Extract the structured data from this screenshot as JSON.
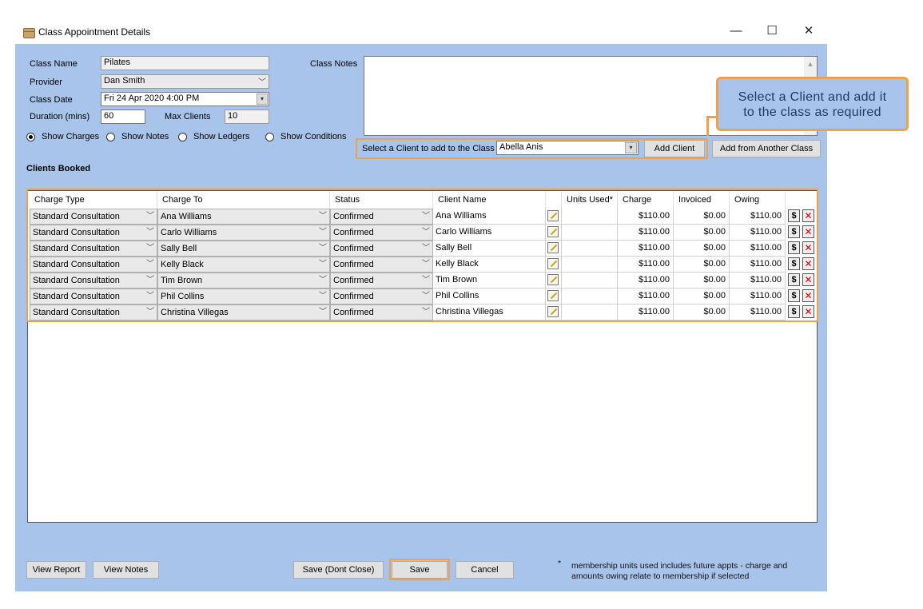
{
  "window": {
    "title": "Class Appointment Details",
    "controls": [
      "—",
      "☐",
      "✕"
    ]
  },
  "form": {
    "class_name_label": "Class Name",
    "class_name": "Pilates",
    "provider_label": "Provider",
    "provider": "Dan Smith",
    "class_date_label": "Class Date",
    "class_date": "Fri  24  Apr  2020   4:00 PM",
    "duration_label": "Duration (mins)",
    "duration": "60",
    "max_clients_label": "Max Clients",
    "max_clients": "10",
    "class_notes_label": "Class Notes",
    "radios": [
      {
        "label": "Show Charges",
        "checked": true
      },
      {
        "label": "Show Notes",
        "checked": false
      },
      {
        "label": "Show Ledgers",
        "checked": false
      },
      {
        "label": "Show Conditions",
        "checked": false
      }
    ],
    "select_client_label": "Select a Client to add to the Class",
    "select_client_value": "Abella Anis",
    "add_client_label": "Add Client",
    "add_from_another_label": "Add from Another Class",
    "clients_booked_label": "Clients Booked"
  },
  "callout": {
    "line1": "Select a Client and add it",
    "line2": "to the class as required"
  },
  "grid": {
    "columns": [
      "Charge Type",
      "Charge To",
      "Status",
      "Client Name",
      "",
      "Units Used*",
      "Charge",
      "Invoiced",
      "Owing"
    ],
    "rows": [
      {
        "charge_type": "Standard Consultation",
        "charge_to": "Ana Williams",
        "status": "Confirmed",
        "client": "Ana Williams",
        "units": "",
        "charge": "$110.00",
        "invoiced": "$0.00",
        "owing": "$110.00"
      },
      {
        "charge_type": "Standard Consultation",
        "charge_to": "Carlo Williams",
        "status": "Confirmed",
        "client": "Carlo Williams",
        "units": "",
        "charge": "$110.00",
        "invoiced": "$0.00",
        "owing": "$110.00"
      },
      {
        "charge_type": "Standard Consultation",
        "charge_to": "Sally Bell",
        "status": "Confirmed",
        "client": "Sally Bell",
        "units": "",
        "charge": "$110.00",
        "invoiced": "$0.00",
        "owing": "$110.00"
      },
      {
        "charge_type": "Standard Consultation",
        "charge_to": "Kelly Black",
        "status": "Confirmed",
        "client": "Kelly Black",
        "units": "",
        "charge": "$110.00",
        "invoiced": "$0.00",
        "owing": "$110.00"
      },
      {
        "charge_type": "Standard Consultation",
        "charge_to": "Tim Brown",
        "status": "Confirmed",
        "client": "Tim Brown",
        "units": "",
        "charge": "$110.00",
        "invoiced": "$0.00",
        "owing": "$110.00"
      },
      {
        "charge_type": "Standard Consultation",
        "charge_to": "Phil Collins",
        "status": "Confirmed",
        "client": "Phil Collins",
        "units": "",
        "charge": "$110.00",
        "invoiced": "$0.00",
        "owing": "$110.00"
      },
      {
        "charge_type": "Standard Consultation",
        "charge_to": "Christina Villegas",
        "status": "Confirmed",
        "client": "Christina Villegas",
        "units": "",
        "charge": "$110.00",
        "invoiced": "$0.00",
        "owing": "$110.00"
      }
    ],
    "dollar_symbol": "$",
    "delete_symbol": "✕"
  },
  "footer": {
    "view_report": "View Report",
    "view_notes": "View Notes",
    "save_dont_close": "Save (Dont Close)",
    "save": "Save",
    "cancel": "Cancel",
    "note_bullet": "*",
    "note_line1": "membership units used includes future appts - charge and",
    "note_line2": "amounts owing relate to membership if selected"
  },
  "colors": {
    "panel": "#a9c4eb",
    "highlight": "#f0a04b",
    "delete": "#d00000"
  }
}
